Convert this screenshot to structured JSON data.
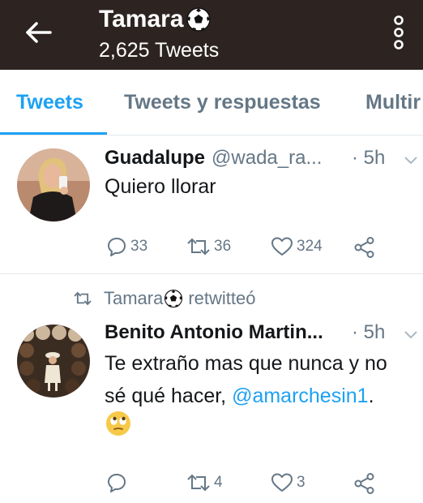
{
  "header": {
    "title": "Tamara",
    "tweet_count": "2,625 Tweets"
  },
  "tabs": [
    {
      "label": "Tweets",
      "active": true
    },
    {
      "label": "Tweets y respuestas",
      "active": false
    },
    {
      "label": "Multir",
      "active": false
    }
  ],
  "tweets": [
    {
      "name": "Guadalupe",
      "handle": "@wada_ra...",
      "time": "· 5h",
      "text": "Quiero llorar",
      "actions": {
        "replies": "33",
        "retweets": "36",
        "likes": "324"
      }
    },
    {
      "retweet_by": "Tamara",
      "retweet_label": "retwitteó",
      "name": "Benito Antonio Martin...",
      "time": "· 5h",
      "text_line1": "Te extraño mas que nunca y no",
      "text_line2_prefix": "sé qué hacer, ",
      "mention": "@amarchesin1",
      "text_line2_suffix": ".",
      "emoji": "rolling-eyes-emoji",
      "actions": {
        "replies": "",
        "retweets": "4",
        "likes": "3"
      }
    }
  ],
  "colors": {
    "header_bg": "#2d2422",
    "accent": "#1da1f2",
    "muted": "#657786"
  },
  "icons": [
    "back-arrow-icon",
    "kebab-menu-icon",
    "soccer-ball-icon",
    "reply-icon",
    "retweet-icon",
    "like-icon",
    "share-icon",
    "chevron-down-icon"
  ]
}
